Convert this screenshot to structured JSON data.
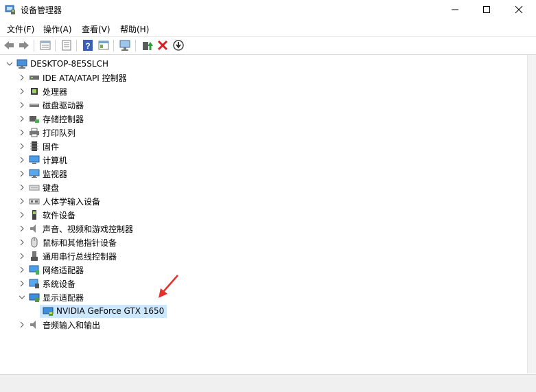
{
  "window": {
    "title": "设备管理器",
    "controls": {
      "minimize": "—",
      "maximize": "☐",
      "close": "✕"
    }
  },
  "menu": [
    "文件(F)",
    "操作(A)",
    "查看(V)",
    "帮助(H)"
  ],
  "toolbar": {
    "icons": [
      "back-icon",
      "forward-icon",
      "properties-icon",
      "view-icon",
      "help-icon",
      "view-resources-icon",
      "scan-hardware-icon",
      "update-driver-icon",
      "uninstall-icon",
      "disable-icon"
    ]
  },
  "tree": {
    "root": "DESKTOP-8E5SLCH",
    "categories": [
      {
        "label": "IDE ATA/ATAPI 控制器",
        "icon": "ide-controller-icon"
      },
      {
        "label": "处理器",
        "icon": "processor-icon"
      },
      {
        "label": "磁盘驱动器",
        "icon": "disk-drive-icon"
      },
      {
        "label": "存储控制器",
        "icon": "storage-controller-icon"
      },
      {
        "label": "打印队列",
        "icon": "printer-icon"
      },
      {
        "label": "固件",
        "icon": "firmware-icon"
      },
      {
        "label": "计算机",
        "icon": "computer-icon"
      },
      {
        "label": "监视器",
        "icon": "monitor-icon"
      },
      {
        "label": "键盘",
        "icon": "keyboard-icon"
      },
      {
        "label": "人体学输入设备",
        "icon": "hid-icon"
      },
      {
        "label": "软件设备",
        "icon": "software-device-icon"
      },
      {
        "label": "声音、视频和游戏控制器",
        "icon": "sound-icon"
      },
      {
        "label": "鼠标和其他指针设备",
        "icon": "mouse-icon"
      },
      {
        "label": "通用串行总线控制器",
        "icon": "usb-icon"
      },
      {
        "label": "网络适配器",
        "icon": "network-adapter-icon"
      },
      {
        "label": "系统设备",
        "icon": "system-device-icon"
      },
      {
        "label": "显示适配器",
        "icon": "display-adapter-icon",
        "expanded": true
      },
      {
        "label": "音频输入和输出",
        "icon": "audio-io-icon"
      }
    ],
    "display_child": "NVIDIA GeForce GTX 1650"
  },
  "colors": {
    "selection": "#cce8ff",
    "annotation_arrow": "#e8302a"
  }
}
